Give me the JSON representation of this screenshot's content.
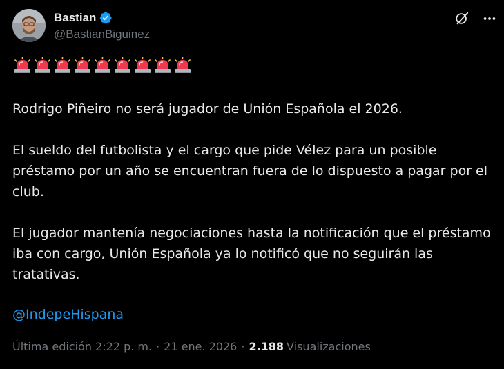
{
  "author": {
    "display_name": "Bastian",
    "handle": "@BastianBiguinez",
    "verified": true
  },
  "actions": {
    "grok_icon": "slash-circle-icon",
    "more_icon": "more-dots-icon"
  },
  "sirens": {
    "count": 9,
    "emoji": "rotating-light"
  },
  "tweet": {
    "paragraphs": [
      "Rodrigo Piñeiro no será jugador de Unión Española el 2026.",
      "El sueldo del futbolista y el cargo que pide Vélez para un posible préstamo por un año se encuentran fuera de lo dispuesto a pagar por el club.",
      "El jugador mantenía negociaciones hasta la notificación que el préstamo iba con cargo, Unión Española ya lo notificó que no seguirán las tratativas."
    ],
    "mention": "@IndepeHispana"
  },
  "meta": {
    "edited_label": "Última edición 2:22 p. m.",
    "separator": "·",
    "date": "21 ene. 2026",
    "views_count": "2.188",
    "views_label": "Visualizaciones"
  },
  "colors": {
    "background": "#000000",
    "text": "#e7e9ea",
    "muted": "#71767b",
    "link": "#1d9bf0",
    "verified": "#1d9bf0",
    "siren_red": "#f0384e"
  }
}
